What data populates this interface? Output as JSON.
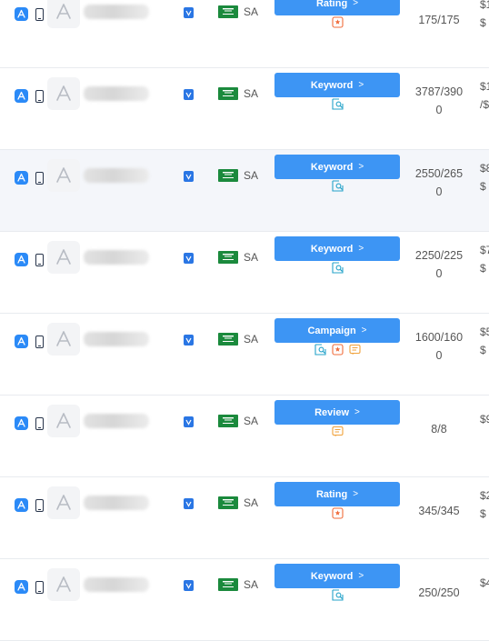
{
  "rows": [
    {
      "country": "SA",
      "button": "Rating",
      "icons": [
        "star"
      ],
      "progress": [
        "175/175"
      ],
      "price": [
        "$1",
        "$"
      ],
      "highlight": false
    },
    {
      "country": "SA",
      "button": "Keyword",
      "icons": [
        "keyword"
      ],
      "progress": [
        "3787/390",
        "0"
      ],
      "price": [
        "$1",
        "/$"
      ],
      "highlight": false
    },
    {
      "country": "SA",
      "button": "Keyword",
      "icons": [
        "keyword"
      ],
      "progress": [
        "2550/265",
        "0"
      ],
      "price": [
        "$8",
        "$"
      ],
      "highlight": true
    },
    {
      "country": "SA",
      "button": "Keyword",
      "icons": [
        "keyword"
      ],
      "progress": [
        "2250/225",
        "0"
      ],
      "price": [
        "$7",
        "$"
      ],
      "highlight": false
    },
    {
      "country": "SA",
      "button": "Campaign",
      "icons": [
        "keyword",
        "star",
        "review"
      ],
      "progress": [
        "1600/160",
        "0"
      ],
      "price": [
        "$5",
        "$"
      ],
      "highlight": false
    },
    {
      "country": "SA",
      "button": "Review",
      "icons": [
        "review"
      ],
      "progress": [
        "8/8"
      ],
      "price": [
        "$9"
      ],
      "highlight": false
    },
    {
      "country": "SA",
      "button": "Rating",
      "icons": [
        "star"
      ],
      "progress": [
        "345/345"
      ],
      "price": [
        "$2",
        "$"
      ],
      "highlight": false
    },
    {
      "country": "SA",
      "button": "Keyword",
      "icons": [
        "keyword"
      ],
      "progress": [
        "250/250"
      ],
      "price": [
        "$4"
      ],
      "highlight": false
    }
  ],
  "icon_colors": {
    "star": "#f06b3a",
    "keyword": "#25a3c9",
    "review": "#f0a13a",
    "primary": "#3d95f4"
  }
}
